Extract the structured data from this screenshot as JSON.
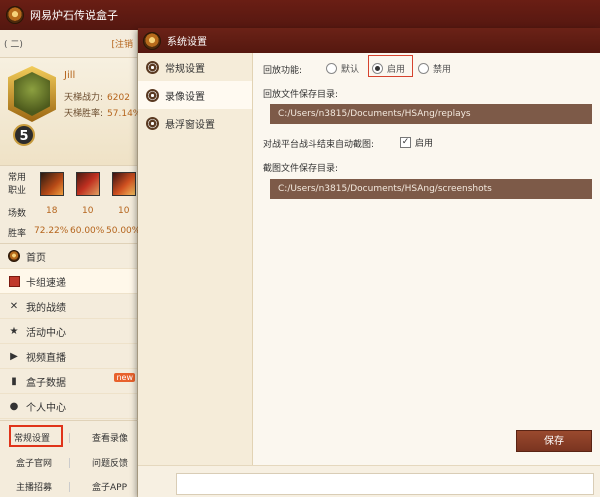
{
  "app": {
    "title": "网易炉石传说盒子",
    "user_status": "( 二)",
    "app_switch": "[注销"
  },
  "profile": {
    "username": "Jill",
    "level": "5",
    "ladder_power_label": "天梯战力:",
    "ladder_power_value": "6202",
    "ladder_winrate_label": "天梯胜率:",
    "ladder_winrate_value": "57.14%"
  },
  "hero_stats": {
    "label_line1": "常用",
    "label_line2": "职业",
    "count_label": "场数",
    "counts": [
      "18",
      "10",
      "10"
    ],
    "winrate_label": "胜率",
    "winrates": [
      "72.22%",
      "60.00%",
      "50.00%"
    ]
  },
  "nav": {
    "items": [
      {
        "label": "首页",
        "icon": "hs-logo-icon"
      },
      {
        "label": "卡组速递",
        "icon": "deck-icon"
      },
      {
        "label": "我的战绩",
        "icon": "swords-icon"
      },
      {
        "label": "活动中心",
        "icon": "star-icon"
      },
      {
        "label": "视频直播",
        "icon": "video-icon"
      },
      {
        "label": "盒子数据",
        "icon": "bar-chart-icon",
        "badge": "new"
      },
      {
        "label": "个人中心",
        "icon": "user-icon"
      }
    ]
  },
  "bottom_links": {
    "settings": "常规设置",
    "recordings": "查看录像",
    "official_site": "盒子官网",
    "feedback": "问题反馈",
    "streamer_recruit": "主播招募",
    "mobile_app": "盒子APP"
  },
  "dialog": {
    "title": "系统设置",
    "tabs": [
      "常规设置",
      "录像设置",
      "悬浮窗设置"
    ],
    "replay_label": "回放功能:",
    "replay_options": [
      "默认",
      "启用",
      "禁用"
    ],
    "replay_path_label": "回放文件保存目录:",
    "replay_path": "C:/Users/n3815/Documents/HSAng/replays",
    "auto_screenshot_label": "对战平台战斗结束自动截图:",
    "auto_screenshot_option": "启用",
    "screenshot_path_label": "截图文件保存目录:",
    "screenshot_path": "C:/Users/n3815/Documents/HSAng/screenshots",
    "save_label": "保存"
  },
  "colors": {
    "titlebar": "#5a1a10",
    "accent": "#b5651d",
    "path_field": "#7d5a48",
    "save_button": "#8a3e26",
    "highlight_box": "#e0341a"
  }
}
